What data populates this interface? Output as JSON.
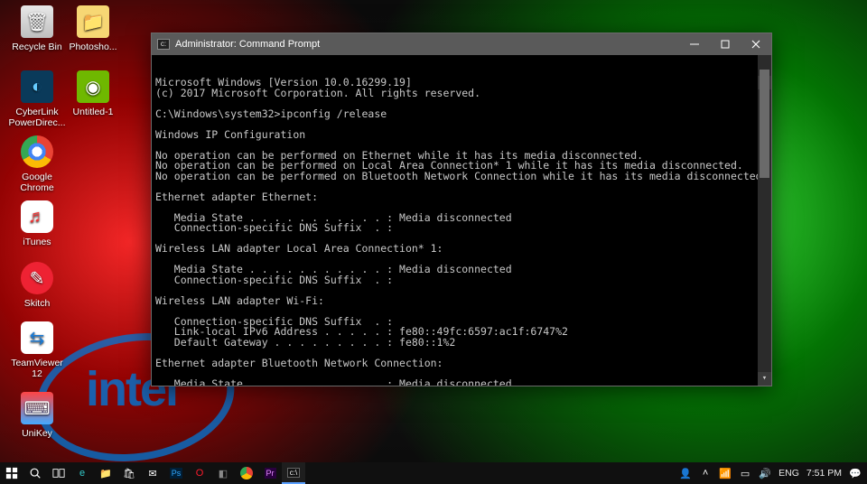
{
  "desktop_icons": [
    {
      "key": "recycle",
      "label": "Recycle Bin"
    },
    {
      "key": "ps",
      "label": "Photosho..."
    },
    {
      "key": "cyberlink",
      "label": "CyberLink PowerDirec..."
    },
    {
      "key": "nvidia",
      "label": "Untitled-1"
    },
    {
      "key": "chrome",
      "label": "Google Chrome"
    },
    {
      "key": "itunes",
      "label": "iTunes"
    },
    {
      "key": "skitch",
      "label": "Skitch"
    },
    {
      "key": "teamv",
      "label": "TeamViewer 12"
    },
    {
      "key": "unikey",
      "label": "UniKey"
    }
  ],
  "cmd": {
    "title": "Administrator: Command Prompt",
    "lines": [
      "Microsoft Windows [Version 10.0.16299.19]",
      "(c) 2017 Microsoft Corporation. All rights reserved.",
      "",
      "C:\\Windows\\system32>ipconfig /release",
      "",
      "Windows IP Configuration",
      "",
      "No operation can be performed on Ethernet while it has its media disconnected.",
      "No operation can be performed on Local Area Connection* 1 while it has its media disconnected.",
      "No operation can be performed on Bluetooth Network Connection while it has its media disconnected.",
      "",
      "Ethernet adapter Ethernet:",
      "",
      "   Media State . . . . . . . . . . . : Media disconnected",
      "   Connection-specific DNS Suffix  . :",
      "",
      "Wireless LAN adapter Local Area Connection* 1:",
      "",
      "   Media State . . . . . . . . . . . : Media disconnected",
      "   Connection-specific DNS Suffix  . :",
      "",
      "Wireless LAN adapter Wi-Fi:",
      "",
      "   Connection-specific DNS Suffix  . :",
      "   Link-local IPv6 Address . . . . . : fe80::49fc:6597:ac1f:6747%2",
      "   Default Gateway . . . . . . . . . : fe80::1%2",
      "",
      "Ethernet adapter Bluetooth Network Connection:",
      "",
      "   Media State . . . . . . . . . . . : Media disconnected"
    ]
  },
  "taskbar": {
    "tray": {
      "lang": "ENG",
      "time": "7:51 PM"
    }
  },
  "brand": {
    "intel": "intel"
  }
}
